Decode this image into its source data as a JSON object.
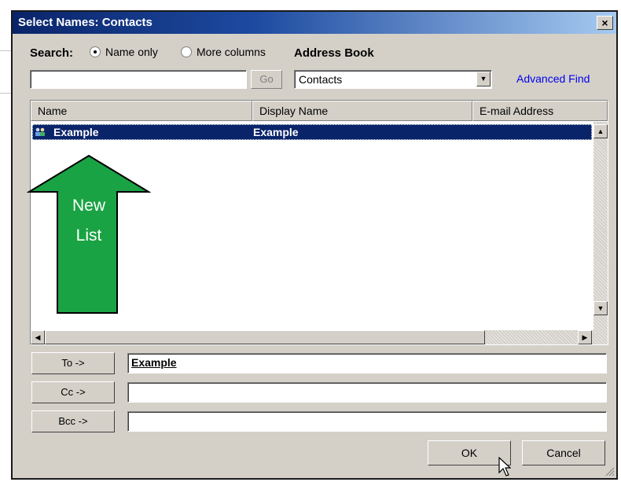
{
  "dialog": {
    "title": "Select Names: Contacts",
    "close_label": "×"
  },
  "search": {
    "label": "Search:",
    "options": [
      {
        "label": "Name only",
        "selected": true
      },
      {
        "label": "More columns",
        "selected": false
      }
    ],
    "input_value": "",
    "go_label": "Go"
  },
  "address_book": {
    "label": "Address Book",
    "selected": "Contacts",
    "advanced_find_label": "Advanced Find"
  },
  "list": {
    "columns": [
      "Name",
      "Display Name",
      "E-mail Address"
    ],
    "rows": [
      {
        "name": "Example",
        "display_name": "Example",
        "email": "",
        "icon": "distribution-list-icon",
        "selected": true
      }
    ]
  },
  "annotation": {
    "line1": "New",
    "line2": "List",
    "color": "#1aa344"
  },
  "recipients": [
    {
      "button": "To ->",
      "value": "Example"
    },
    {
      "button": "Cc ->",
      "value": ""
    },
    {
      "button": "Bcc ->",
      "value": ""
    }
  ],
  "buttons": {
    "ok": "OK",
    "cancel": "Cancel"
  },
  "colors": {
    "selection": "#0a246a",
    "title_start": "#0a246a",
    "link": "#0000ee",
    "face": "#d4d0c8"
  }
}
